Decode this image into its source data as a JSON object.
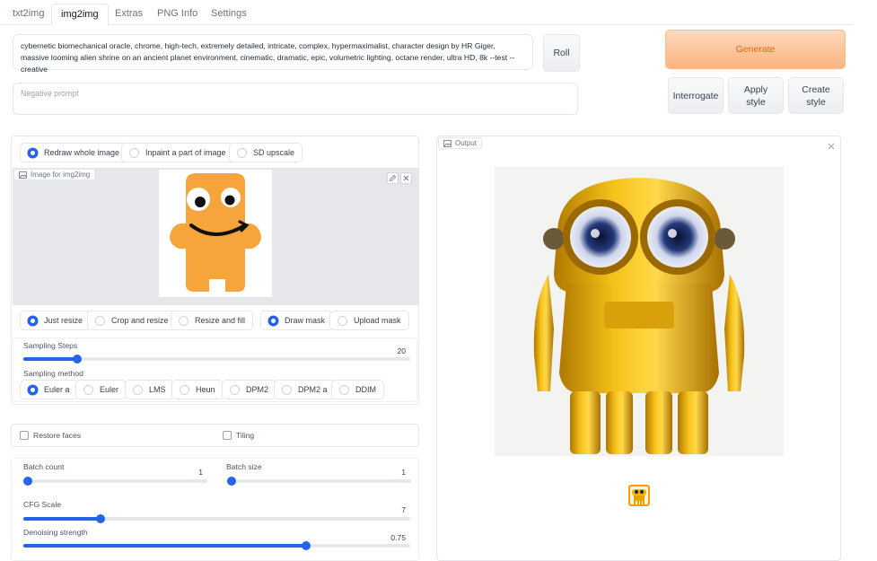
{
  "tabs": [
    "txt2img",
    "img2img",
    "Extras",
    "PNG Info",
    "Settings"
  ],
  "active_tab": "img2img",
  "prompt": {
    "text": "cybernetic biomechanical oracle, chrome, high-tech, extremely detailed, intricate, complex, hypermaximalist, character design by HR Giger, massive looming alien shrine on an ancient planet environment, cinematic, dramatic, epic, volumetric lighting, octane render, ultra HD, 8k --test --creative",
    "negative_placeholder": "Negative prompt"
  },
  "buttons": {
    "roll": "Roll",
    "generate": "Generate",
    "interrogate": "Interrogate",
    "apply_style": "Apply style",
    "create_style": "Create style"
  },
  "mode_options": [
    "Redraw whole image",
    "Inpaint a part of image",
    "SD upscale"
  ],
  "mode_selected": "Redraw whole image",
  "image_label": "Image for img2img",
  "resize_options": [
    "Just resize",
    "Crop and resize",
    "Resize and fill"
  ],
  "resize_selected": "Just resize",
  "mask_options": [
    "Draw mask",
    "Upload mask"
  ],
  "mask_selected": "Draw mask",
  "sampling_steps": {
    "label": "Sampling Steps",
    "value": "20",
    "fraction": 0.14
  },
  "sampling_method": {
    "label": "Sampling method",
    "options": [
      "Euler a",
      "Euler",
      "LMS",
      "Heun",
      "DPM2",
      "DPM2 a",
      "DDIM"
    ],
    "selected": "Euler a"
  },
  "restore_faces": "Restore faces",
  "tiling": "Tiling",
  "batch_count": {
    "label": "Batch count",
    "value": "1",
    "fraction": 0.0
  },
  "batch_size": {
    "label": "Batch size",
    "value": "1",
    "fraction": 0.0
  },
  "cfg_scale": {
    "label": "CFG Scale",
    "value": "7",
    "fraction": 0.2
  },
  "denoising": {
    "label": "Denoising strength",
    "value": "0.75",
    "fraction": 0.73
  },
  "output_label": "Output",
  "colors": {
    "accent": "#2563eb",
    "generate": "#fbb47f",
    "generate_text": "#e8660f",
    "robot": "#f0b400",
    "mascot": "#f5a53b"
  }
}
